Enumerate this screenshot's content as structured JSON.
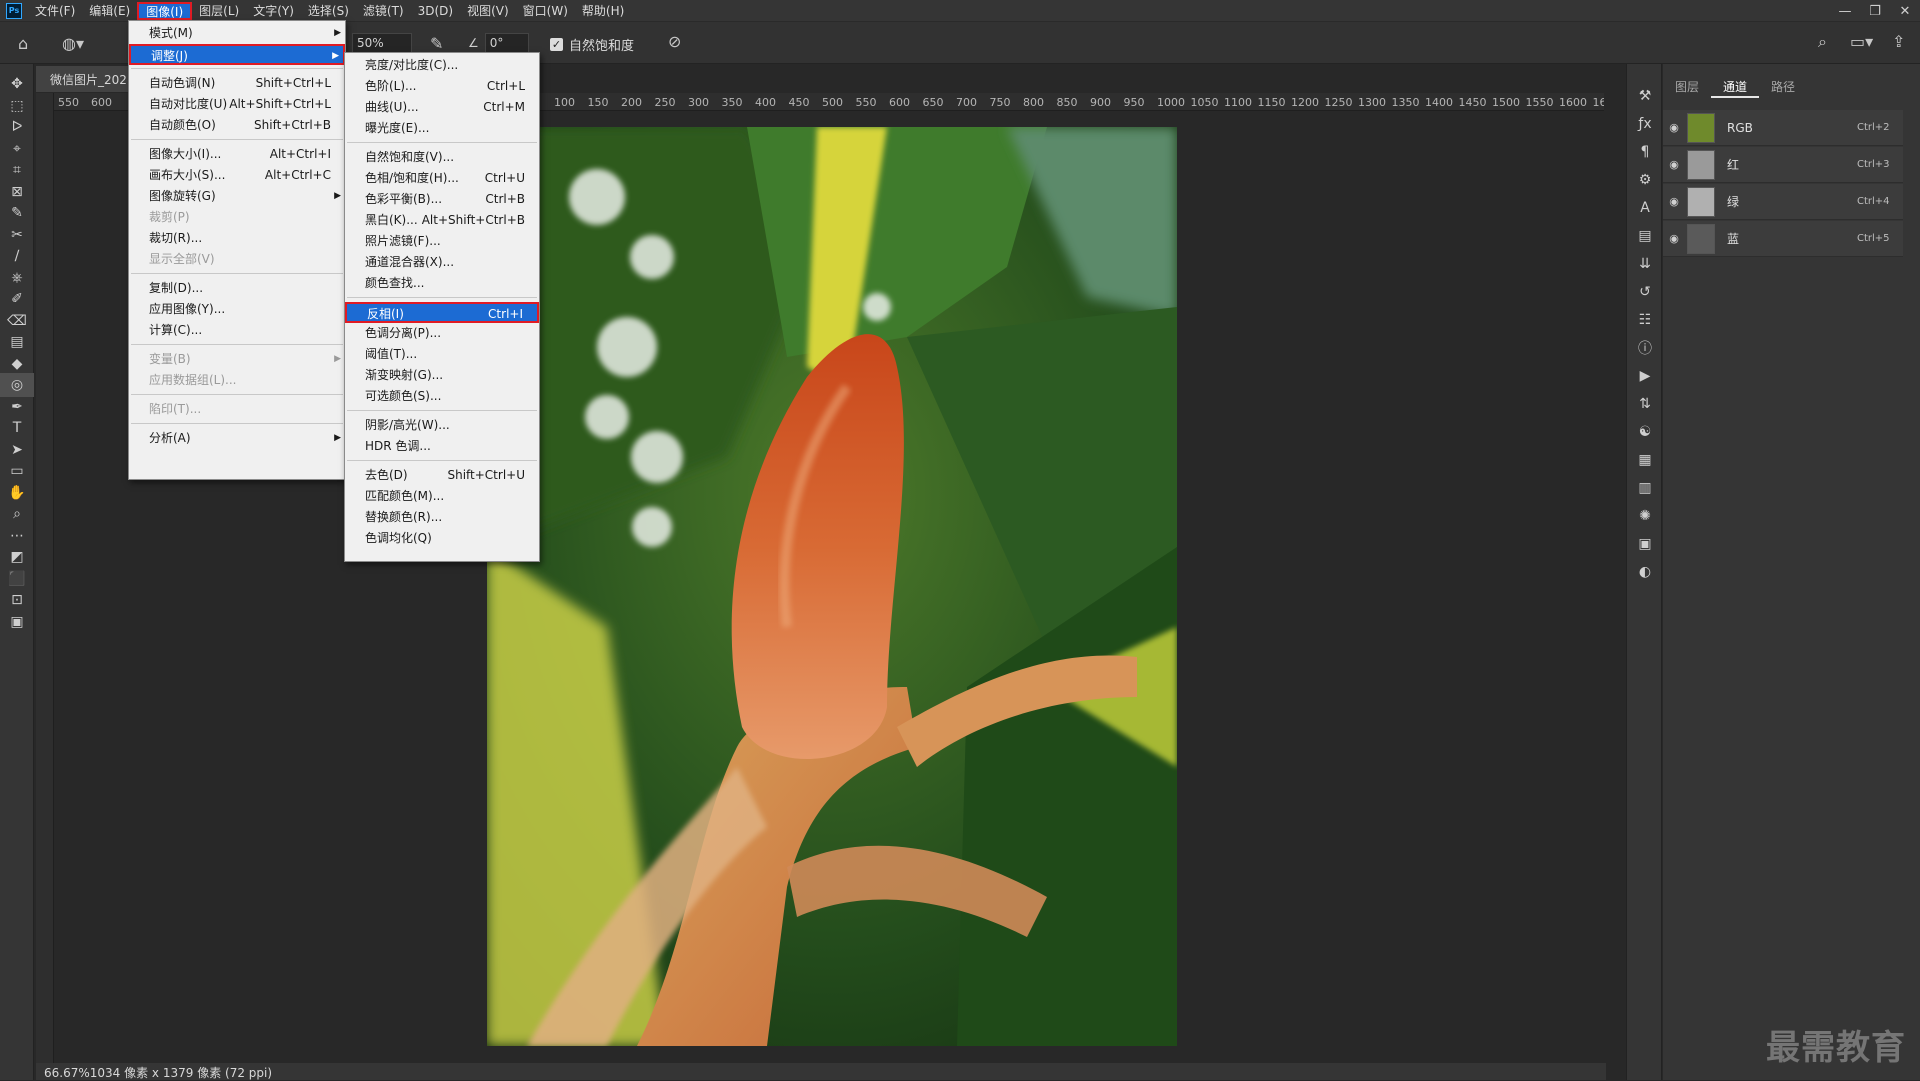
{
  "app": {
    "logo": "Ps"
  },
  "menubar": {
    "items": [
      "文件(F)",
      "编辑(E)",
      "图像(I)",
      "图层(L)",
      "文字(Y)",
      "选择(S)",
      "滤镜(T)",
      "3D(D)",
      "视图(V)",
      "窗口(W)",
      "帮助(H)"
    ],
    "active_index": 2
  },
  "window_controls": {
    "minimize": "—",
    "restore": "❐",
    "close": "✕"
  },
  "options": {
    "percent": "50%",
    "angle": "0°",
    "vibrance_label": "自然饱和度",
    "vibrance_checked": true
  },
  "document": {
    "tab_title": "微信图片_202",
    "status": "66.67%1034 像素 x 1379 像素 (72 ppi)"
  },
  "ruler": {
    "top_left_labels": [
      "550",
      "600"
    ],
    "top_right_labels": [
      "100",
      "150",
      "200",
      "250",
      "300",
      "350",
      "400",
      "450",
      "500",
      "550",
      "600",
      "650",
      "700",
      "750",
      "800",
      "850",
      "900",
      "950",
      "1000",
      "1050",
      "1100",
      "1150",
      "1200",
      "1250",
      "1300",
      "1350",
      "1400",
      "1450",
      "1500",
      "1550",
      "1600",
      "16"
    ]
  },
  "image_menu": {
    "items": [
      {
        "label": "模式(M)",
        "shortcut": "",
        "submenu": true,
        "disabled": false
      },
      {
        "label": "调整(J)",
        "shortcut": "",
        "submenu": true,
        "disabled": false,
        "highlight": true
      },
      {
        "sep": true
      },
      {
        "label": "自动色调(N)",
        "shortcut": "Shift+Ctrl+L"
      },
      {
        "label": "自动对比度(U)",
        "shortcut": "Alt+Shift+Ctrl+L"
      },
      {
        "label": "自动颜色(O)",
        "shortcut": "Shift+Ctrl+B"
      },
      {
        "sep": true
      },
      {
        "label": "图像大小(I)...",
        "shortcut": "Alt+Ctrl+I"
      },
      {
        "label": "画布大小(S)...",
        "shortcut": "Alt+Ctrl+C"
      },
      {
        "label": "图像旋转(G)",
        "shortcut": "",
        "submenu": true
      },
      {
        "label": "裁剪(P)",
        "shortcut": "",
        "disabled": true
      },
      {
        "label": "裁切(R)...",
        "shortcut": ""
      },
      {
        "label": "显示全部(V)",
        "shortcut": "",
        "disabled": true
      },
      {
        "sep": true
      },
      {
        "label": "复制(D)...",
        "shortcut": ""
      },
      {
        "label": "应用图像(Y)...",
        "shortcut": ""
      },
      {
        "label": "计算(C)...",
        "shortcut": ""
      },
      {
        "sep": true
      },
      {
        "label": "变量(B)",
        "shortcut": "",
        "submenu": true,
        "disabled": true
      },
      {
        "label": "应用数据组(L)...",
        "shortcut": "",
        "disabled": true
      },
      {
        "sep": true
      },
      {
        "label": "陷印(T)...",
        "shortcut": "",
        "disabled": true
      },
      {
        "sep": true
      },
      {
        "label": "分析(A)",
        "shortcut": "",
        "submenu": true
      }
    ]
  },
  "adjust_menu": {
    "items": [
      {
        "label": "亮度/对比度(C)...",
        "shortcut": ""
      },
      {
        "label": "色阶(L)...",
        "shortcut": "Ctrl+L"
      },
      {
        "label": "曲线(U)...",
        "shortcut": "Ctrl+M"
      },
      {
        "label": "曝光度(E)...",
        "shortcut": ""
      },
      {
        "sep": true
      },
      {
        "label": "自然饱和度(V)...",
        "shortcut": ""
      },
      {
        "label": "色相/饱和度(H)...",
        "shortcut": "Ctrl+U"
      },
      {
        "label": "色彩平衡(B)...",
        "shortcut": "Ctrl+B"
      },
      {
        "label": "黑白(K)...",
        "shortcut": "Alt+Shift+Ctrl+B"
      },
      {
        "label": "照片滤镜(F)...",
        "shortcut": ""
      },
      {
        "label": "通道混合器(X)...",
        "shortcut": ""
      },
      {
        "label": "颜色查找...",
        "shortcut": ""
      },
      {
        "sep": true
      },
      {
        "label": "反相(I)",
        "shortcut": "Ctrl+I",
        "highlight": true
      },
      {
        "label": "色调分离(P)...",
        "shortcut": ""
      },
      {
        "label": "阈值(T)...",
        "shortcut": ""
      },
      {
        "label": "渐变映射(G)...",
        "shortcut": ""
      },
      {
        "label": "可选颜色(S)...",
        "shortcut": ""
      },
      {
        "sep": true
      },
      {
        "label": "阴影/高光(W)...",
        "shortcut": ""
      },
      {
        "label": "HDR 色调...",
        "shortcut": ""
      },
      {
        "sep": true
      },
      {
        "label": "去色(D)",
        "shortcut": "Shift+Ctrl+U"
      },
      {
        "label": "匹配颜色(M)...",
        "shortcut": ""
      },
      {
        "label": "替换颜色(R)...",
        "shortcut": ""
      },
      {
        "label": "色调均化(Q)",
        "shortcut": ""
      }
    ]
  },
  "panel": {
    "tabs": [
      "图层",
      "通道",
      "路径"
    ],
    "active_tab": 1,
    "channels": [
      {
        "name": "RGB",
        "shortcut": "Ctrl+2",
        "thumb": "#6f8a2c"
      },
      {
        "name": "红",
        "shortcut": "Ctrl+3",
        "thumb": "#9a9a9a"
      },
      {
        "name": "绿",
        "shortcut": "Ctrl+4",
        "thumb": "#b0b0b0"
      },
      {
        "name": "蓝",
        "shortcut": "Ctrl+5",
        "thumb": "#5a5a5a"
      }
    ]
  },
  "watermark": "最需教育",
  "colors": {
    "highlight": "#1c6bd3",
    "outline_red": "#e01b24",
    "menu_bg": "#f0f0f0"
  }
}
